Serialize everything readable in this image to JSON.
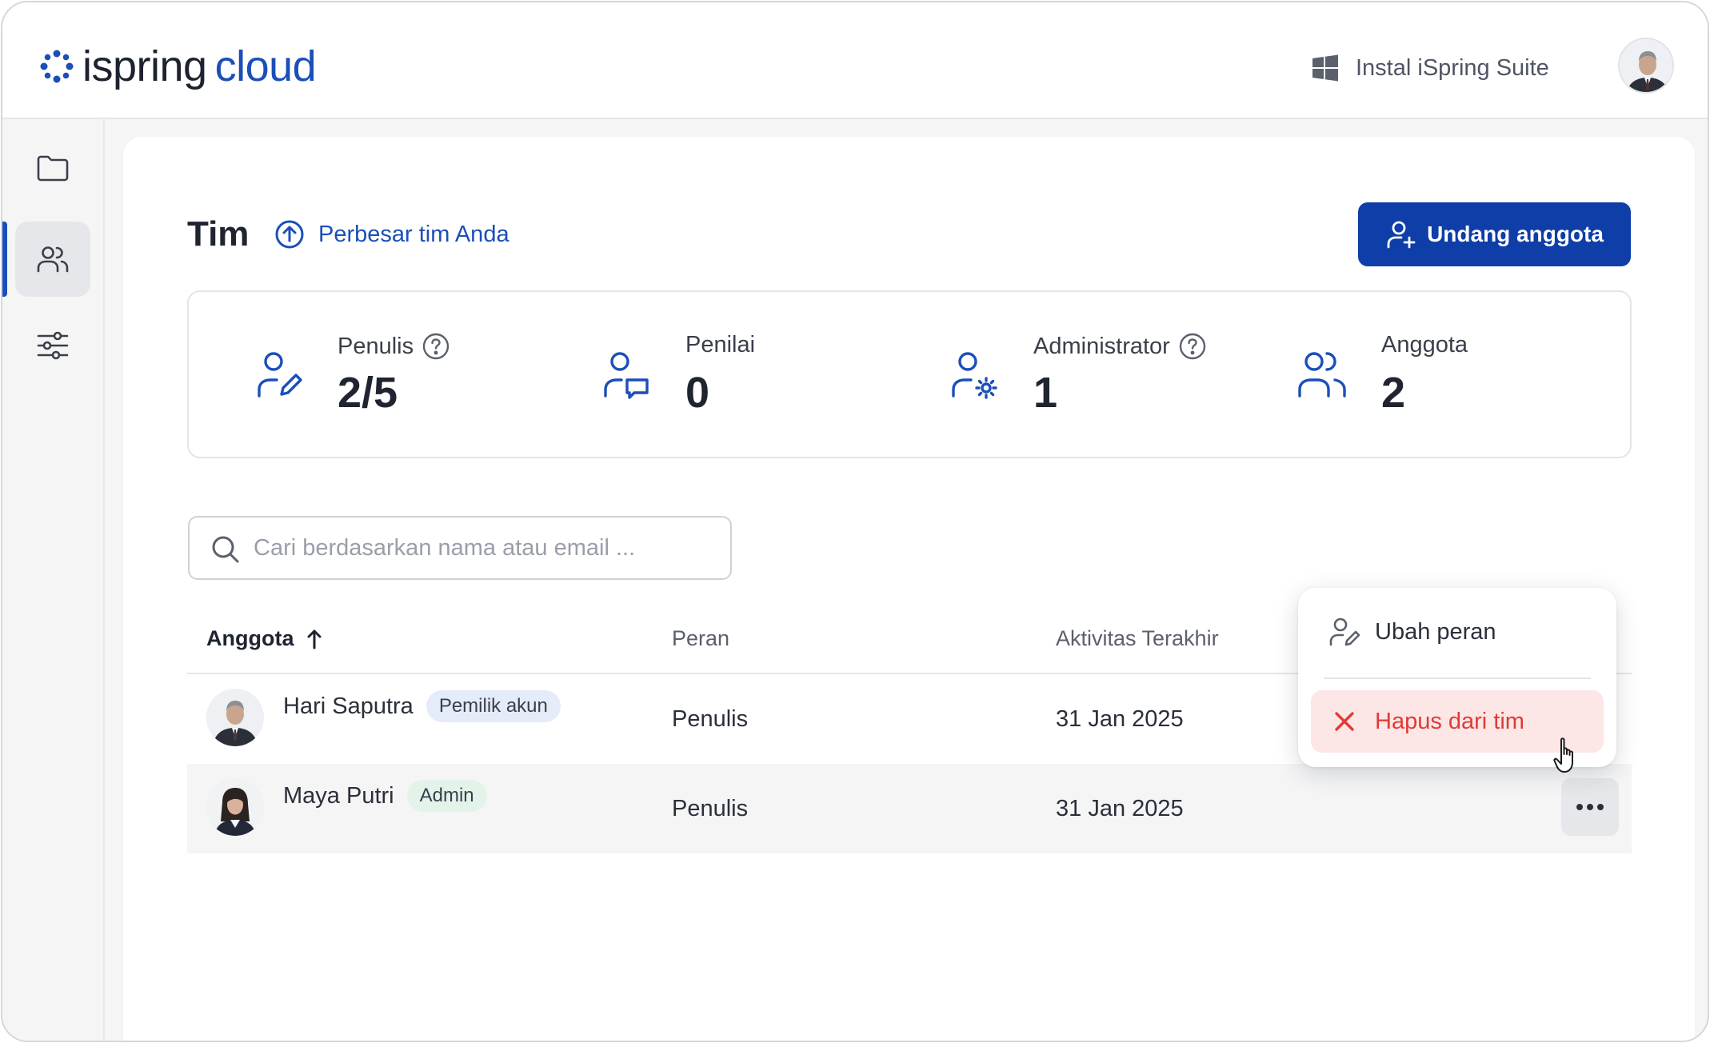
{
  "header": {
    "logo_ispring": "ispring",
    "logo_cloud": "cloud",
    "install_label": "Instal iSpring Suite",
    "install_icon": "windows-icon",
    "avatar_icon": "user-avatar"
  },
  "sidebar": {
    "items": [
      {
        "name": "folder",
        "icon": "folder-icon",
        "active": false
      },
      {
        "name": "team",
        "icon": "users-icon",
        "active": true
      },
      {
        "name": "settings",
        "icon": "sliders-icon",
        "active": false
      }
    ]
  },
  "page": {
    "title": "Tim",
    "grow_label": "Perbesar tim Anda",
    "invite_label": "Undang anggota"
  },
  "stats": [
    {
      "label": "Penulis",
      "value": "2/5",
      "icon": "author-edit-icon",
      "help": true
    },
    {
      "label": "Penilai",
      "value": "0",
      "icon": "reviewer-comment-icon",
      "help": false
    },
    {
      "label": "Administrator",
      "value": "1",
      "icon": "admin-gear-icon",
      "help": true
    },
    {
      "label": "Anggota",
      "value": "2",
      "icon": "members-icon",
      "help": false
    }
  ],
  "search": {
    "placeholder": "Cari berdasarkan nama atau email ..."
  },
  "table": {
    "columns": [
      "Anggota",
      "Peran",
      "Aktivitas Terakhir"
    ],
    "sort_column": "Anggota",
    "sort_direction": "ascending",
    "rows": [
      {
        "name": "Hari Saputra",
        "badge": "Pemilik akun",
        "role": "Penulis",
        "last_activity": "31 Jan 2025"
      },
      {
        "name": "Maya Putri",
        "badge": "Admin",
        "role": "Penulis",
        "last_activity": "31 Jan 2025"
      }
    ]
  },
  "menu": {
    "items": [
      {
        "label": "Ubah peran",
        "icon": "user-edit-icon"
      },
      {
        "label": "Hapus dari tim",
        "icon": "close-icon"
      }
    ]
  },
  "colors": {
    "brand_blue": "#0f3ea8",
    "link_blue": "#1b4fb8",
    "danger_red": "#e03b36",
    "danger_bg": "#fde6e6"
  }
}
